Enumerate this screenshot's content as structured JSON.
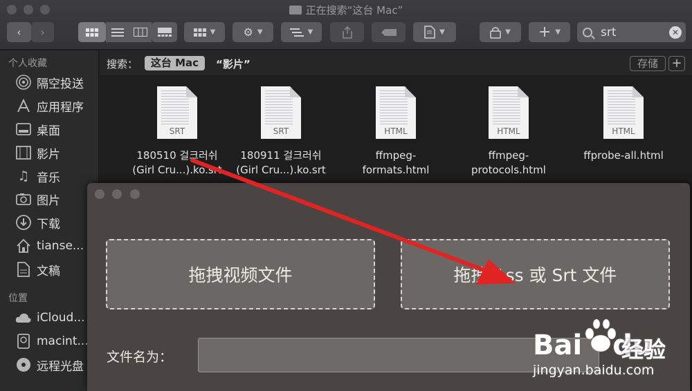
{
  "window": {
    "title": "正在搜索“这台 Mac”"
  },
  "toolbar": {
    "back_icon": "chevron-left-icon",
    "forward_icon": "chevron-right-icon",
    "view_icons": [
      "icon-view-icon",
      "list-view-icon",
      "column-view-icon",
      "gallery-view-icon"
    ],
    "search_value": "srt"
  },
  "sidebar": {
    "favorites_heading": "个人收藏",
    "favorites": [
      {
        "label": "隔空投送",
        "icon": "airdrop-icon"
      },
      {
        "label": "应用程序",
        "icon": "applications-icon"
      },
      {
        "label": "桌面",
        "icon": "desktop-icon"
      },
      {
        "label": "影片",
        "icon": "movies-icon"
      },
      {
        "label": "音乐",
        "icon": "music-icon"
      },
      {
        "label": "图片",
        "icon": "pictures-icon"
      },
      {
        "label": "下载",
        "icon": "downloads-icon"
      },
      {
        "label": "tianse...",
        "icon": "home-icon"
      },
      {
        "label": "文稿",
        "icon": "documents-icon"
      }
    ],
    "locations_heading": "位置",
    "locations": [
      {
        "label": "iCloud...",
        "icon": "cloud-icon"
      },
      {
        "label": "macint...",
        "icon": "disk-icon"
      },
      {
        "label": "远程光盘",
        "icon": "remote-disc-icon"
      }
    ]
  },
  "scope": {
    "label": "搜索：",
    "this_mac": "这台 Mac",
    "movies": "“影片”",
    "save": "存储",
    "add": "+"
  },
  "files": [
    {
      "ext": "SRT",
      "name_line1": "180510 걸크러쉬",
      "name_line2": "(Girl Cru...).ko.srt"
    },
    {
      "ext": "SRT",
      "name_line1": "180911 걸크러쉬",
      "name_line2": "(Girl Cru...).ko.srt"
    },
    {
      "ext": "HTML",
      "name_line1": "ffmpeg-",
      "name_line2": "formats.html"
    },
    {
      "ext": "HTML",
      "name_line1": "ffmpeg-",
      "name_line2": "protocols.html"
    },
    {
      "ext": "HTML",
      "name_line1": "ffprobe-all.html",
      "name_line2": ""
    }
  ],
  "app": {
    "drop_video": "拖拽视频文件",
    "drop_subtitle": "拖拽 Ass 或 Srt 文件",
    "filename_label": "文件名为：",
    "filename_value": ""
  },
  "watermark": {
    "logo_text_1": "Bai",
    "logo_text_2": "du",
    "cn_text": "经验",
    "url": "jingyan.baidu.com"
  },
  "colors": {
    "arrow": "#e02424"
  }
}
